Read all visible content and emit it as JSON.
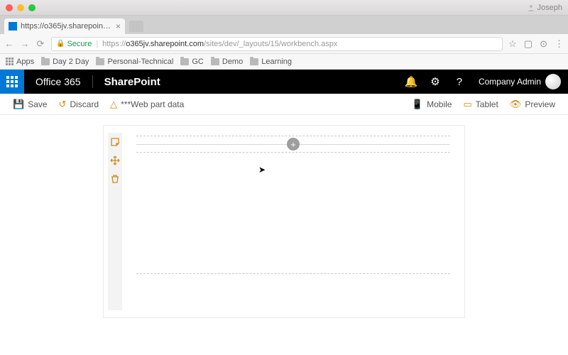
{
  "window": {
    "profile_name": "Joseph"
  },
  "browser": {
    "tab_title": "https://o365jv.sharepoint.com",
    "secure_label": "Secure",
    "url_prefix": "https://",
    "url_host": "o365jv.sharepoint.com",
    "url_path": "/sites/dev/_layouts/15/workbench.aspx"
  },
  "bookmarks": {
    "apps": "Apps",
    "items": [
      "Day 2 Day",
      "Personal-Technical",
      "GC",
      "Demo",
      "Learning"
    ]
  },
  "suite": {
    "o365": "Office 365",
    "product": "SharePoint",
    "admin": "Company Admin"
  },
  "commands": {
    "save": "Save",
    "discard": "Discard",
    "webpart": "***Web part data",
    "mobile": "Mobile",
    "tablet": "Tablet",
    "preview": "Preview"
  },
  "canvas": {
    "add_label": "+"
  }
}
